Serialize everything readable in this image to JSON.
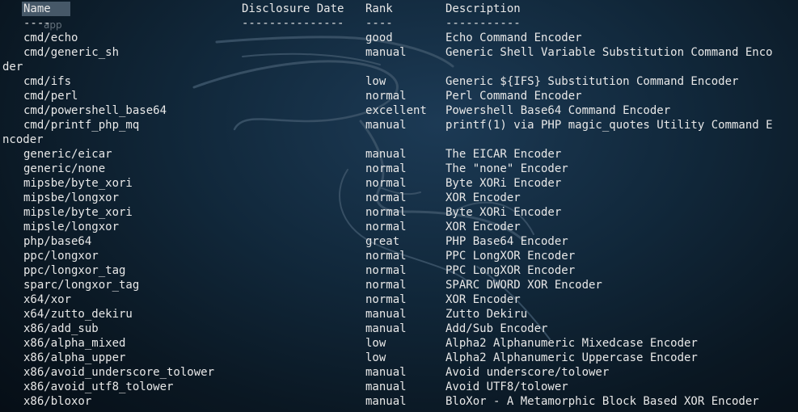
{
  "header": {
    "name": "Name",
    "date": "Disclosure Date",
    "rank": "Rank",
    "desc": "Description"
  },
  "separator": {
    "name": "----",
    "date": "---------------",
    "rank": "----",
    "desc": "-----------"
  },
  "ghost_label": "app",
  "encoders": [
    {
      "name": "cmd/echo",
      "rank": "good",
      "desc": "Echo Command Encoder",
      "wrap": ""
    },
    {
      "name": "cmd/generic_sh",
      "rank": "manual",
      "desc": "Generic Shell Variable Substitution Command Enco",
      "wrap": "der"
    },
    {
      "name": "cmd/ifs",
      "rank": "low",
      "desc": "Generic ${IFS} Substitution Command Encoder",
      "wrap": ""
    },
    {
      "name": "cmd/perl",
      "rank": "normal",
      "desc": "Perl Command Encoder",
      "wrap": ""
    },
    {
      "name": "cmd/powershell_base64",
      "rank": "excellent",
      "desc": "Powershell Base64 Command Encoder",
      "wrap": ""
    },
    {
      "name": "cmd/printf_php_mq",
      "rank": "manual",
      "desc": "printf(1) via PHP magic_quotes Utility Command E",
      "wrap": "ncoder"
    },
    {
      "name": "generic/eicar",
      "rank": "manual",
      "desc": "The EICAR Encoder",
      "wrap": ""
    },
    {
      "name": "generic/none",
      "rank": "normal",
      "desc": "The \"none\" Encoder",
      "wrap": ""
    },
    {
      "name": "mipsbe/byte_xori",
      "rank": "normal",
      "desc": "Byte XORi Encoder",
      "wrap": ""
    },
    {
      "name": "mipsbe/longxor",
      "rank": "normal",
      "desc": "XOR Encoder",
      "wrap": ""
    },
    {
      "name": "mipsle/byte_xori",
      "rank": "normal",
      "desc": "Byte XORi Encoder",
      "wrap": ""
    },
    {
      "name": "mipsle/longxor",
      "rank": "normal",
      "desc": "XOR Encoder",
      "wrap": ""
    },
    {
      "name": "php/base64",
      "rank": "great",
      "desc": "PHP Base64 Encoder",
      "wrap": ""
    },
    {
      "name": "ppc/longxor",
      "rank": "normal",
      "desc": "PPC LongXOR Encoder",
      "wrap": ""
    },
    {
      "name": "ppc/longxor_tag",
      "rank": "normal",
      "desc": "PPC LongXOR Encoder",
      "wrap": ""
    },
    {
      "name": "sparc/longxor_tag",
      "rank": "normal",
      "desc": "SPARC DWORD XOR Encoder",
      "wrap": ""
    },
    {
      "name": "x64/xor",
      "rank": "normal",
      "desc": "XOR Encoder",
      "wrap": ""
    },
    {
      "name": "x64/zutto_dekiru",
      "rank": "manual",
      "desc": "Zutto Dekiru",
      "wrap": ""
    },
    {
      "name": "x86/add_sub",
      "rank": "manual",
      "desc": "Add/Sub Encoder",
      "wrap": ""
    },
    {
      "name": "x86/alpha_mixed",
      "rank": "low",
      "desc": "Alpha2 Alphanumeric Mixedcase Encoder",
      "wrap": ""
    },
    {
      "name": "x86/alpha_upper",
      "rank": "low",
      "desc": "Alpha2 Alphanumeric Uppercase Encoder",
      "wrap": ""
    },
    {
      "name": "x86/avoid_underscore_tolower",
      "rank": "manual",
      "desc": "Avoid underscore/tolower",
      "wrap": ""
    },
    {
      "name": "x86/avoid_utf8_tolower",
      "rank": "manual",
      "desc": "Avoid UTF8/tolower",
      "wrap": ""
    },
    {
      "name": "x86/bloxor",
      "rank": "manual",
      "desc": "BloXor - A Metamorphic Block Based XOR Encoder",
      "wrap": ""
    }
  ]
}
